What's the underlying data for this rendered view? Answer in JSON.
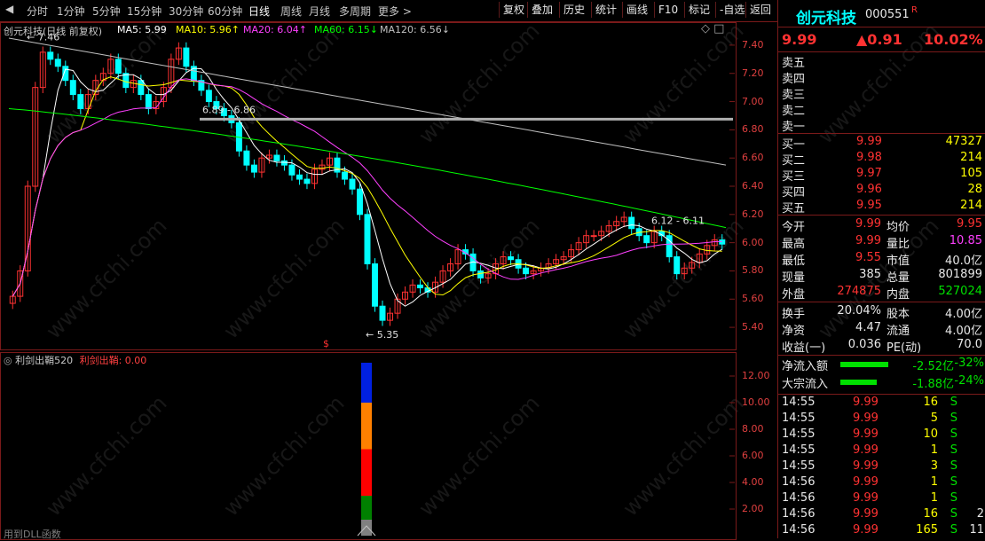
{
  "toolbar": {
    "periods": [
      "分时",
      "1分钟",
      "5分钟",
      "15分钟",
      "30分钟",
      "60分钟",
      "日线",
      "周线",
      "月线",
      "多周期",
      "更多 >"
    ],
    "active_period": "日线",
    "buttons": [
      "复权",
      "叠加",
      "历史",
      "统计",
      "画线",
      "F10",
      "标记",
      "-自选",
      "返回"
    ]
  },
  "chart": {
    "title": "创元科技(日线 前复权)",
    "ma": [
      {
        "label": "MA5: 5.99",
        "color": "#ffffff"
      },
      {
        "label": "MA10: 5.96↑",
        "color": "#ffff00"
      },
      {
        "label": "MA20: 6.04↑",
        "color": "#ff40ff"
      },
      {
        "label": "MA60: 6.15↓",
        "color": "#00ff00"
      },
      {
        "label": "MA120: 6.56↓",
        "color": "#c0c0c0"
      }
    ],
    "y_ticks": [
      "7.40",
      "7.20",
      "7.00",
      "6.80",
      "6.60",
      "6.40",
      "6.20",
      "6.00",
      "5.80",
      "5.60",
      "5.40"
    ],
    "annotations": {
      "high": "7.46",
      "low": "5.35",
      "range1": "6.89 - 6.86",
      "range2": "6.12 - 6.11",
      "signal": "$"
    }
  },
  "indicator": {
    "title": "利剑出鞘520",
    "value_label": "利剑出鞘: 0.00",
    "y_ticks": [
      "12.00",
      "10.00",
      "8.00",
      "6.00",
      "4.00",
      "2.00"
    ],
    "bar_segments": [
      "#0020e0",
      "#ff8000",
      "#ff0000",
      "#008000",
      "#808080"
    ],
    "footer": "用到DLL函数"
  },
  "quote": {
    "name": "创元科技",
    "code": "000551",
    "r": "R",
    "price": "9.99",
    "change": "▲0.91",
    "pct": "10.02%",
    "sells": [
      {
        "label": "卖五",
        "price": "",
        "vol": ""
      },
      {
        "label": "卖四",
        "price": "",
        "vol": ""
      },
      {
        "label": "卖三",
        "price": "",
        "vol": ""
      },
      {
        "label": "卖二",
        "price": "",
        "vol": ""
      },
      {
        "label": "卖一",
        "price": "",
        "vol": ""
      }
    ],
    "buys": [
      {
        "label": "买一",
        "price": "9.99",
        "vol": "47327"
      },
      {
        "label": "买二",
        "price": "9.98",
        "vol": "214"
      },
      {
        "label": "买三",
        "price": "9.97",
        "vol": "105"
      },
      {
        "label": "买四",
        "price": "9.96",
        "vol": "28"
      },
      {
        "label": "买五",
        "price": "9.95",
        "vol": "214"
      }
    ],
    "stats1": [
      {
        "l1": "今开",
        "v1": "9.99",
        "l2": "均价",
        "v2": "9.95"
      },
      {
        "l1": "最高",
        "v1": "9.99",
        "l2": "量比",
        "v2": "10.85"
      },
      {
        "l1": "最低",
        "v1": "9.55",
        "l2": "市值",
        "v2": "40.0亿"
      },
      {
        "l1": "现量",
        "v1": "385",
        "l2": "总量",
        "v2": "801899"
      },
      {
        "l1": "外盘",
        "v1": "274875",
        "l2": "内盘",
        "v2": "527024"
      }
    ],
    "stats2": [
      {
        "l1": "换手",
        "v1": "20.04%",
        "l2": "股本",
        "v2": "4.00亿"
      },
      {
        "l1": "净资",
        "v1": "4.47",
        "l2": "流通",
        "v2": "4.00亿"
      },
      {
        "l1": "收益(一)",
        "v1": "0.036",
        "l2": "PE(动)",
        "v2": "70.0"
      }
    ],
    "flows": [
      {
        "label": "净流入额",
        "value": "-2.52亿",
        "pct": "-32%",
        "bar": 0.6
      },
      {
        "label": "大宗流入",
        "value": "-1.88亿",
        "pct": "-24%",
        "bar": 0.45
      }
    ],
    "ticks": [
      {
        "time": "14:55",
        "price": "9.99",
        "vol": "16",
        "side": "S",
        "n": ""
      },
      {
        "time": "14:55",
        "price": "9.99",
        "vol": "5",
        "side": "S",
        "n": ""
      },
      {
        "time": "14:55",
        "price": "9.99",
        "vol": "10",
        "side": "S",
        "n": ""
      },
      {
        "time": "14:55",
        "price": "9.99",
        "vol": "1",
        "side": "S",
        "n": ""
      },
      {
        "time": "14:55",
        "price": "9.99",
        "vol": "3",
        "side": "S",
        "n": ""
      },
      {
        "time": "14:56",
        "price": "9.99",
        "vol": "1",
        "side": "S",
        "n": ""
      },
      {
        "time": "14:56",
        "price": "9.99",
        "vol": "1",
        "side": "S",
        "n": ""
      },
      {
        "time": "14:56",
        "price": "9.99",
        "vol": "16",
        "side": "S",
        "n": "2"
      },
      {
        "time": "14:56",
        "price": "9.99",
        "vol": "165",
        "side": "S",
        "n": "11"
      }
    ]
  },
  "watermark": "www.cfchi.com"
}
